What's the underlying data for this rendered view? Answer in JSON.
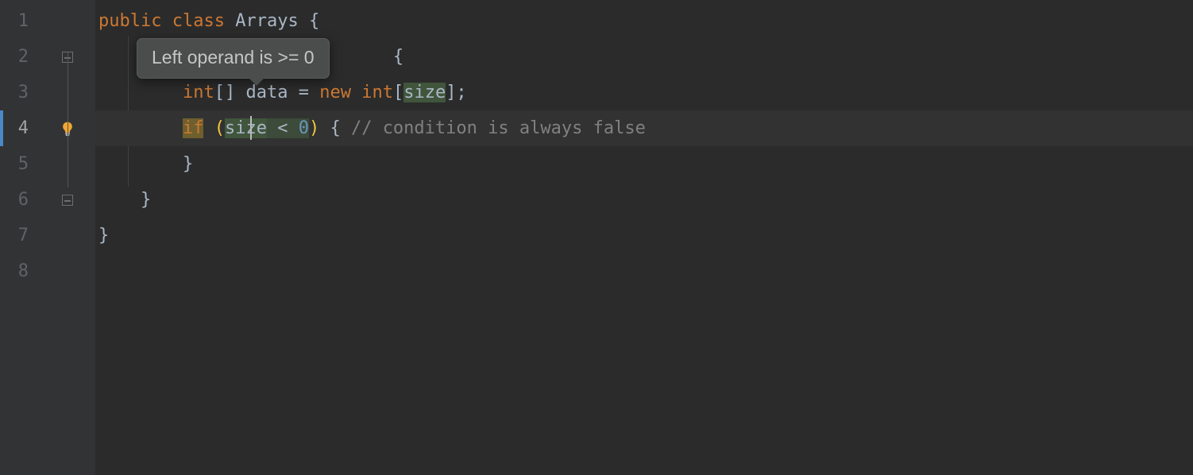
{
  "gutter": {
    "lines": [
      "1",
      "2",
      "3",
      "4",
      "5",
      "6",
      "7",
      "8"
    ],
    "caretLine": 4
  },
  "tooltip": {
    "text": "Left operand is >= 0"
  },
  "code": {
    "l1": {
      "kw_public": "public",
      "kw_class": "class",
      "cls": "Arrays",
      "brace": "{"
    },
    "l2": {
      "brace": "{"
    },
    "l3": {
      "type_int": "int",
      "arr": "[]",
      "ident_data": "data",
      "eq": "=",
      "kw_new": "new",
      "type_int2": "int",
      "lb": "[",
      "size": "size",
      "rb": "];"
    },
    "l4": {
      "kw_if": "if",
      "lp": "(",
      "size": "size",
      "lt": "<",
      "zero": "0",
      "rp": ")",
      "brace": "{",
      "cmt": "// condition is always false"
    },
    "l5": {
      "brace": "}"
    },
    "l6": {
      "brace": "}"
    },
    "l7": {
      "brace": "}"
    }
  }
}
